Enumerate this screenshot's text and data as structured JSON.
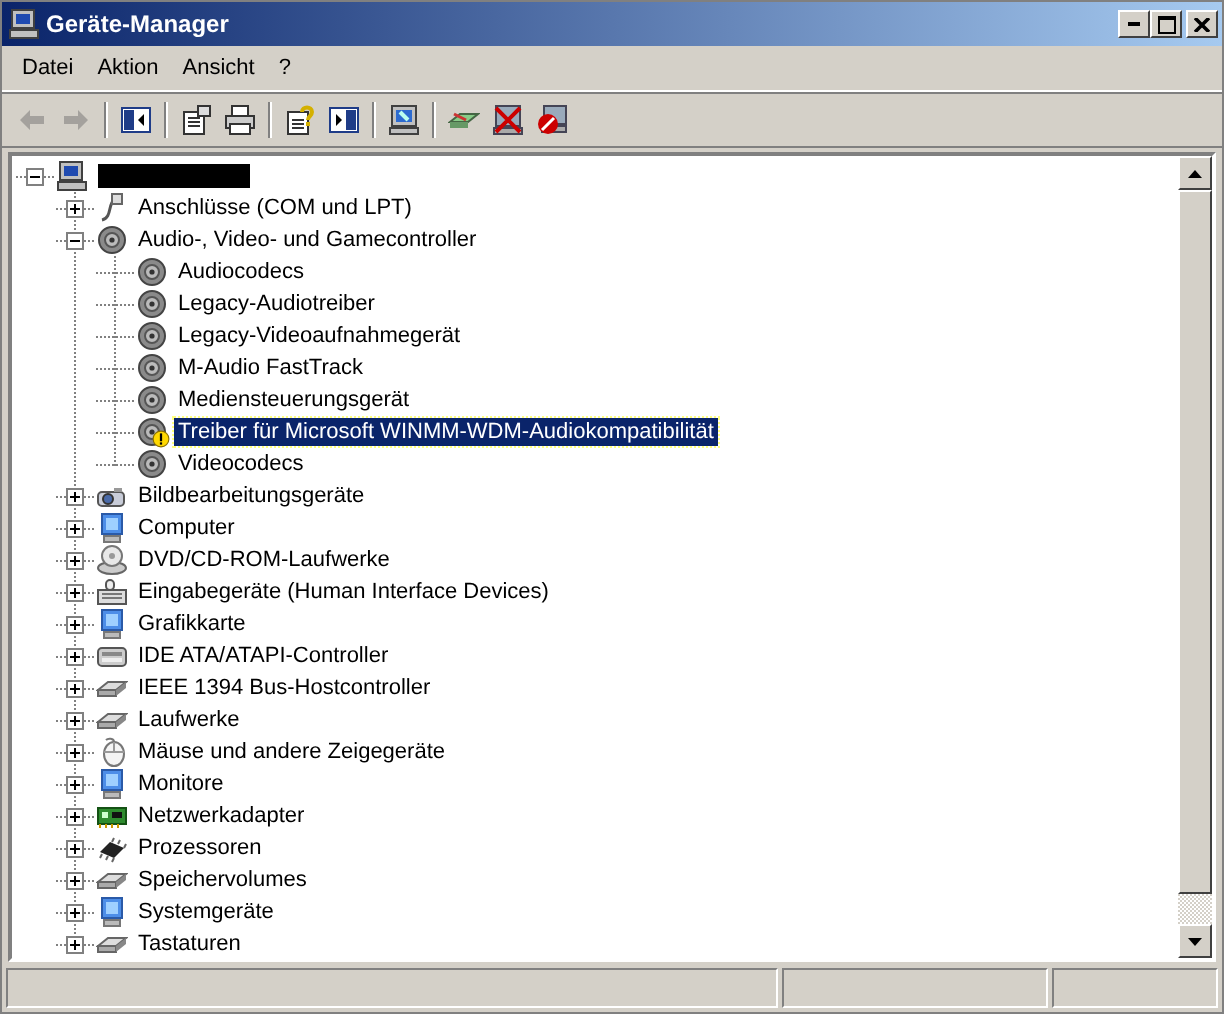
{
  "window": {
    "title": "Geräte-Manager"
  },
  "menu": [
    {
      "label": "Datei"
    },
    {
      "label": "Aktion"
    },
    {
      "label": "Ansicht"
    },
    {
      "label": "?"
    }
  ],
  "toolbar": [
    {
      "kind": "back",
      "disabled": true
    },
    {
      "kind": "forward",
      "disabled": true
    },
    {
      "kind": "separator"
    },
    {
      "kind": "tree",
      "disabled": false
    },
    {
      "kind": "separator"
    },
    {
      "kind": "properties",
      "disabled": false
    },
    {
      "kind": "print",
      "disabled": false
    },
    {
      "kind": "separator"
    },
    {
      "kind": "help",
      "disabled": false
    },
    {
      "kind": "pane",
      "disabled": false
    },
    {
      "kind": "separator"
    },
    {
      "kind": "scan",
      "disabled": false
    },
    {
      "kind": "separator"
    },
    {
      "kind": "update",
      "disabled": false
    },
    {
      "kind": "uninstall",
      "disabled": false
    },
    {
      "kind": "disable",
      "disabled": false
    }
  ],
  "tree": [
    {
      "kind": "computer",
      "expanded": true,
      "children": [
        {
          "label": "Anschlüsse (COM und LPT)",
          "kind": "port",
          "expanded": false
        },
        {
          "label": "Audio-, Video- und Gamecontroller",
          "kind": "speaker",
          "expanded": true,
          "children": [
            {
              "label": "Audiocodecs",
              "kind": "speaker",
              "selected": false,
              "warning": false
            },
            {
              "label": "Legacy-Audiotreiber",
              "kind": "speaker",
              "selected": false,
              "warning": false
            },
            {
              "label": "Legacy-Videoaufnahmegerät",
              "kind": "speaker",
              "selected": false,
              "warning": false
            },
            {
              "label": "M-Audio FastTrack",
              "kind": "speaker",
              "selected": false,
              "warning": false
            },
            {
              "label": "Mediensteuerungsgerät",
              "kind": "speaker",
              "selected": false,
              "warning": false
            },
            {
              "label": "Treiber für Microsoft WINMM-WDM-Audiokompatibilität",
              "kind": "speaker",
              "selected": true,
              "warning": true
            },
            {
              "label": "Videocodecs",
              "kind": "speaker",
              "selected": false,
              "warning": false
            }
          ]
        },
        {
          "label": "Bildbearbeitungsgeräte",
          "kind": "camera",
          "expanded": false
        },
        {
          "label": "Computer",
          "kind": "monitor",
          "expanded": false
        },
        {
          "label": "DVD/CD-ROM-Laufwerke",
          "kind": "disc",
          "expanded": false
        },
        {
          "label": "Eingabegeräte (Human Interface Devices)",
          "kind": "keyboard",
          "expanded": false
        },
        {
          "label": "Grafikkarte",
          "kind": "monitor",
          "expanded": false
        },
        {
          "label": "IDE ATA/ATAPI-Controller",
          "kind": "ide",
          "expanded": false
        },
        {
          "label": "IEEE 1394 Bus-Hostcontroller",
          "kind": "drive",
          "expanded": false
        },
        {
          "label": "Laufwerke",
          "kind": "drive",
          "expanded": false
        },
        {
          "label": "Mäuse und andere Zeigegeräte",
          "kind": "mouse",
          "expanded": false
        },
        {
          "label": "Monitore",
          "kind": "monitor",
          "expanded": false
        },
        {
          "label": "Netzwerkadapter",
          "kind": "network",
          "expanded": false
        },
        {
          "label": "Prozessoren",
          "kind": "cpu",
          "expanded": false
        },
        {
          "label": "Speichervolumes",
          "kind": "drive",
          "expanded": false
        },
        {
          "label": "Systemgeräte",
          "kind": "monitor",
          "expanded": false
        },
        {
          "label": "Tastaturen",
          "kind": "drive",
          "expanded": false
        }
      ]
    }
  ]
}
